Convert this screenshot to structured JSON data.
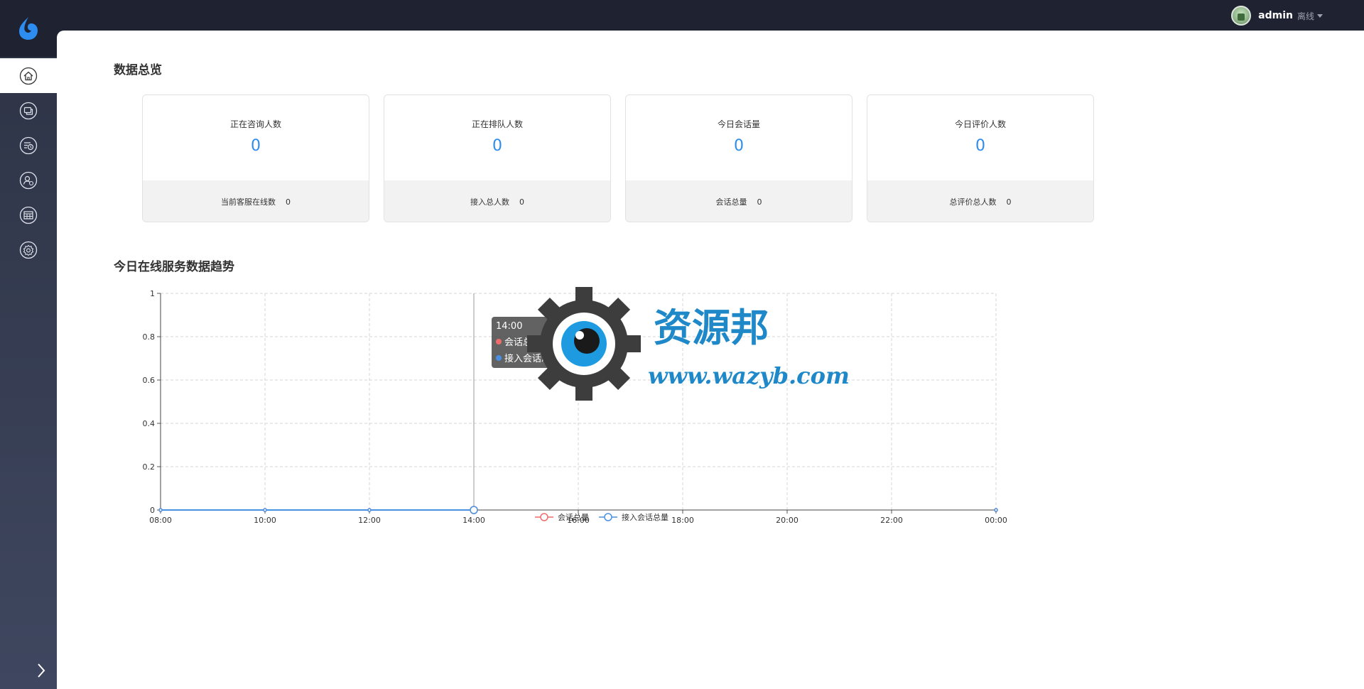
{
  "header": {
    "username": "admin",
    "status": "离线"
  },
  "sidebar": {
    "items": [
      {
        "name": "home",
        "icon": "home-icon",
        "active": true
      },
      {
        "name": "chat",
        "icon": "chat-icon",
        "active": false
      },
      {
        "name": "history",
        "icon": "history-icon",
        "active": false
      },
      {
        "name": "customers",
        "icon": "customer-icon",
        "active": false
      },
      {
        "name": "table",
        "icon": "table-icon",
        "active": false
      },
      {
        "name": "settings",
        "icon": "settings-icon",
        "active": false
      }
    ]
  },
  "overview": {
    "title": "数据总览",
    "cards": [
      {
        "label": "正在咨询人数",
        "value": "0",
        "footer_label": "当前客服在线数",
        "footer_value": "0"
      },
      {
        "label": "正在排队人数",
        "value": "0",
        "footer_label": "接入总人数",
        "footer_value": "0"
      },
      {
        "label": "今日会话量",
        "value": "0",
        "footer_label": "会话总量",
        "footer_value": "0"
      },
      {
        "label": "今日评价人数",
        "value": "0",
        "footer_label": "总评价总人数",
        "footer_value": "0"
      }
    ]
  },
  "trend": {
    "title": "今日在线服务数据趋势"
  },
  "tooltip": {
    "time": "14:00",
    "rows": [
      {
        "label": "会话总量: 0",
        "color": "#f06c6c"
      },
      {
        "label": "接入会话总量: 0",
        "color": "#4a90e2"
      }
    ]
  },
  "watermark": {
    "text_cn": "资源邦",
    "text_url": "www.wazyb.com"
  },
  "chart_data": {
    "type": "line",
    "x": [
      "08:00",
      "10:00",
      "12:00",
      "14:00",
      "16:00",
      "18:00",
      "20:00",
      "22:00",
      "00:00"
    ],
    "series": [
      {
        "name": "会话总量",
        "color": "#f06c6c",
        "values": [
          0,
          0,
          0,
          0,
          null,
          null,
          null,
          null,
          0
        ]
      },
      {
        "name": "接入会话总量",
        "color": "#4a90e2",
        "values": [
          0,
          0,
          0,
          0,
          null,
          null,
          null,
          null,
          0
        ]
      }
    ],
    "ylim": [
      0,
      1
    ],
    "yticks": [
      "0",
      "0.2",
      "0.4",
      "0.6",
      "0.8",
      "1"
    ],
    "grid": true,
    "legend": "bottom-center"
  }
}
